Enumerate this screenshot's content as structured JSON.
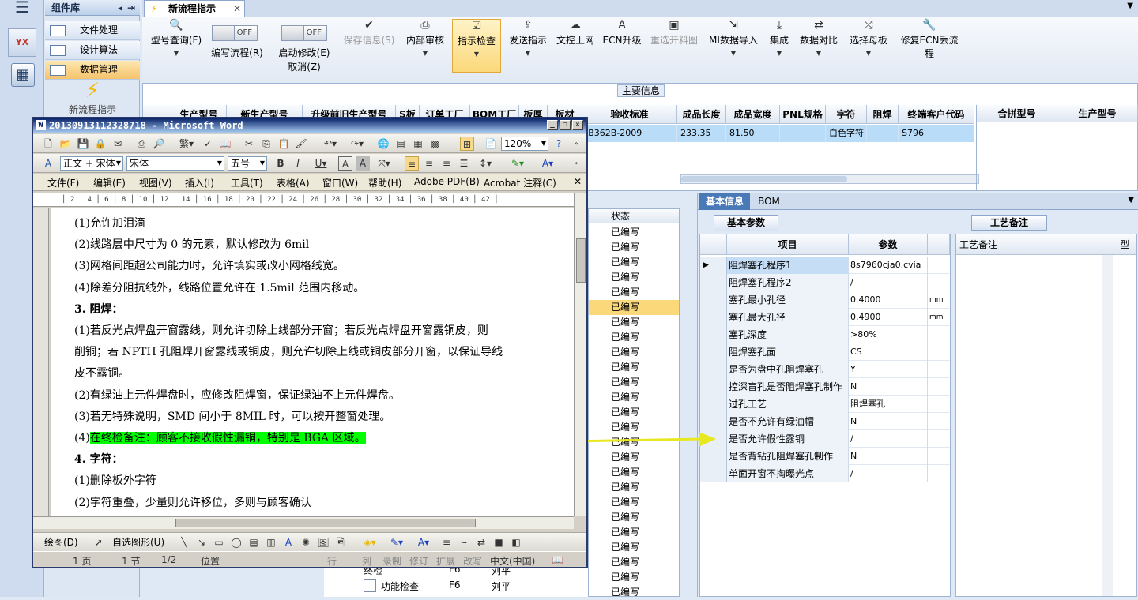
{
  "app": {
    "component_library_title": "组件库",
    "new_flow_tile": "新流程指示"
  },
  "library_items": [
    {
      "label": "文件处理"
    },
    {
      "label": "设计算法"
    },
    {
      "label": "数据管理"
    }
  ],
  "tab": {
    "title": "新流程指示"
  },
  "toolbar": {
    "model_query": "型号查询(F)",
    "edit_flow": "编写流程(R)",
    "edit_flow_toggle": "OFF",
    "enable_modify": "启动修改(E)",
    "enable_modify_toggle": "OFF",
    "cancel": "取消(Z)",
    "save_info": "保存信息(S)",
    "internal_review": "内部审核",
    "instruction_check": "指示检查",
    "send_instruction": "发送指示",
    "upload": "文控上网",
    "ecn_upgrade": "ECN升级",
    "reselect": "重选开料图",
    "mi_import": "MI数据导入",
    "integrate": "集成",
    "data_compare": "数据对比",
    "select_mother": "选择母板",
    "repair_ecn": "修复ECN丢流程"
  },
  "main_info": {
    "title": "主要信息",
    "columns": [
      "生产型号",
      "新生产型号",
      "升级前旧生产型号",
      "S板",
      "订单工厂",
      "BOM工厂",
      "板厚",
      "板材",
      "验收标准",
      "成品长度",
      "成品宽度",
      "PNL规格",
      "字符",
      "阻焊",
      "终端客户代码"
    ],
    "row": {
      "accept_std": "JB362B-2009",
      "length": "233.35",
      "width": "81.50",
      "char": "白色字符",
      "client_code": "S796"
    },
    "merge_cols": [
      "合拼型号",
      "生产型号"
    ]
  },
  "status_list": {
    "header": "状态",
    "items": [
      "已编写",
      "已编写",
      "已编写",
      "已编写",
      "已编写",
      "已编写",
      "已编写",
      "已编写",
      "已编写",
      "已编写",
      "已编写",
      "已编写",
      "已编写",
      "已编写",
      "已编写",
      "已编写",
      "已编写",
      "已编写",
      "已编写",
      "已编写",
      "已编写",
      "已编写",
      "已编写",
      "已编写",
      "已编写"
    ]
  },
  "tree": {
    "item1": "终检",
    "item1_code": "F6",
    "item1_user": "刘平",
    "item2": "功能检查",
    "item2_code": "F6",
    "item2_user": "刘平"
  },
  "info_panel": {
    "tab_basic": "基本信息",
    "tab_bom": "BOM",
    "sub_tab": "基本参数",
    "col_item": "项目",
    "col_param": "参数",
    "rows": [
      {
        "item": "阻焊塞孔程序1",
        "value": "8s7960cja0.cvia",
        "unit": ""
      },
      {
        "item": "阻焊塞孔程序2",
        "value": "/",
        "unit": ""
      },
      {
        "item": "塞孔最小孔径",
        "value": "0.4000",
        "unit": "mm"
      },
      {
        "item": "塞孔最大孔径",
        "value": "0.4900",
        "unit": "mm"
      },
      {
        "item": "塞孔深度",
        "value": ">80%",
        "unit": ""
      },
      {
        "item": "阻焊塞孔面",
        "value": "CS",
        "unit": ""
      },
      {
        "item": "是否为盘中孔阻焊塞孔",
        "value": "Y",
        "unit": ""
      },
      {
        "item": "控深盲孔是否阻焊塞孔制作",
        "value": "N",
        "unit": ""
      },
      {
        "item": "过孔工艺",
        "value": "阻焊塞孔",
        "unit": ""
      },
      {
        "item": "是否不允许有绿油帽",
        "value": "N",
        "unit": ""
      },
      {
        "item": "是否允许假性露铜",
        "value": "/",
        "unit": ""
      },
      {
        "item": "是否背钻孔阻焊塞孔制作",
        "value": "N",
        "unit": ""
      },
      {
        "item": "单面开窗不掏曝光点",
        "value": "/",
        "unit": ""
      }
    ],
    "craft_tab": "工艺备注",
    "craft_col": "工艺备注",
    "craft_col2": "型"
  },
  "word": {
    "title": "20130913112328718 - Microsoft Word",
    "style": "正文 + 宋体",
    "font": "宋体",
    "size": "五号",
    "zoom": "120%",
    "menus": [
      "文件(F)",
      "编辑(E)",
      "视图(V)",
      "插入(I)",
      "工具(T)",
      "表格(A)",
      "窗口(W)",
      "帮助(H)",
      "Adobe PDF(B)",
      "Acrobat 注释(C)"
    ],
    "lines": [
      "(1)允许加泪滴",
      "(2)线路层中尺寸为 0 的元素，默认修改为 6mil",
      "(3)网格间距超公司能力时，允许填实或改小网格线宽。",
      "(4)除差分阻抗线外，线路位置允许在 1.5mil 范围内移动。",
      "3. 阻焊：",
      "(1)若反光点焊盘开窗露线，则允许切除上线部分开窗；若反光点焊盘开窗露铜皮，则",
      "削铜；若 NPTH 孔阻焊开窗露线或铜皮，则允许切除上线或铜皮部分开窗，以保证导线",
      "皮不露铜。",
      "(2)有绿油上元件焊盘时，应修改阻焊窗，保证绿油不上元件焊盘。",
      "(3)若无特殊说明，SMD 间小于 8MIL 时，可以按开整窗处理。",
      "(4)",
      "4. 字符：",
      "(1)删除板外字符",
      "(2)字符重叠，少量则允许移位，多则与顾客确认"
    ],
    "highlight": "在终检备注：顾客不接收假性漏铜，特别是 BGA 区域。",
    "drawbar": {
      "draw": "绘图(D)",
      "autoshape": "自选图形(U)"
    },
    "status": {
      "page": "1 页",
      "section": "1 节",
      "pages": "1/2",
      "pos": "位置",
      "line": "行",
      "col": "列",
      "rec": "录制",
      "rev": "修订",
      "ext": "扩展",
      "ovr": "改写",
      "lang": "中文(中国)"
    }
  },
  "colors": {
    "highlight": "#00ff00",
    "arrow": "#e8e820",
    "selected_row": "#b9dcf8"
  }
}
